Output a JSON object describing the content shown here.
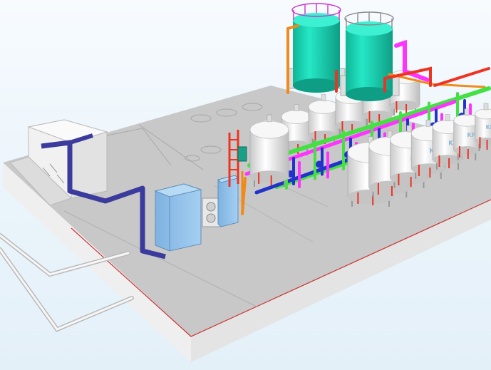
{
  "viewport": {
    "name": "3d-plant-model-view",
    "background": "#eef6fb"
  },
  "brand": {
    "logo_text": "KF"
  },
  "colors": {
    "slab_top": "#c9c9c9",
    "slab_front": "#e6e6e6",
    "slab_side": "#f0f0f0",
    "slab_edge": "#cc3333",
    "storage_tank": "#19d6b4",
    "filter_vessel": "#eeeeee",
    "pipe_green": "#44e044",
    "pipe_magenta": "#ff33ff",
    "pipe_blue": "#2233cc",
    "pipe_red": "#ee3322",
    "pipe_orange": "#f08a1a",
    "pipe_purple": "#3b3b9e",
    "cabinet": "#8fbfe8",
    "handrail": "#cc33cc"
  },
  "components": {
    "storage_tanks": 2,
    "filter_vessels_front_row": 8,
    "filter_vessels_back_row": 6,
    "control_cabinets": 2
  }
}
